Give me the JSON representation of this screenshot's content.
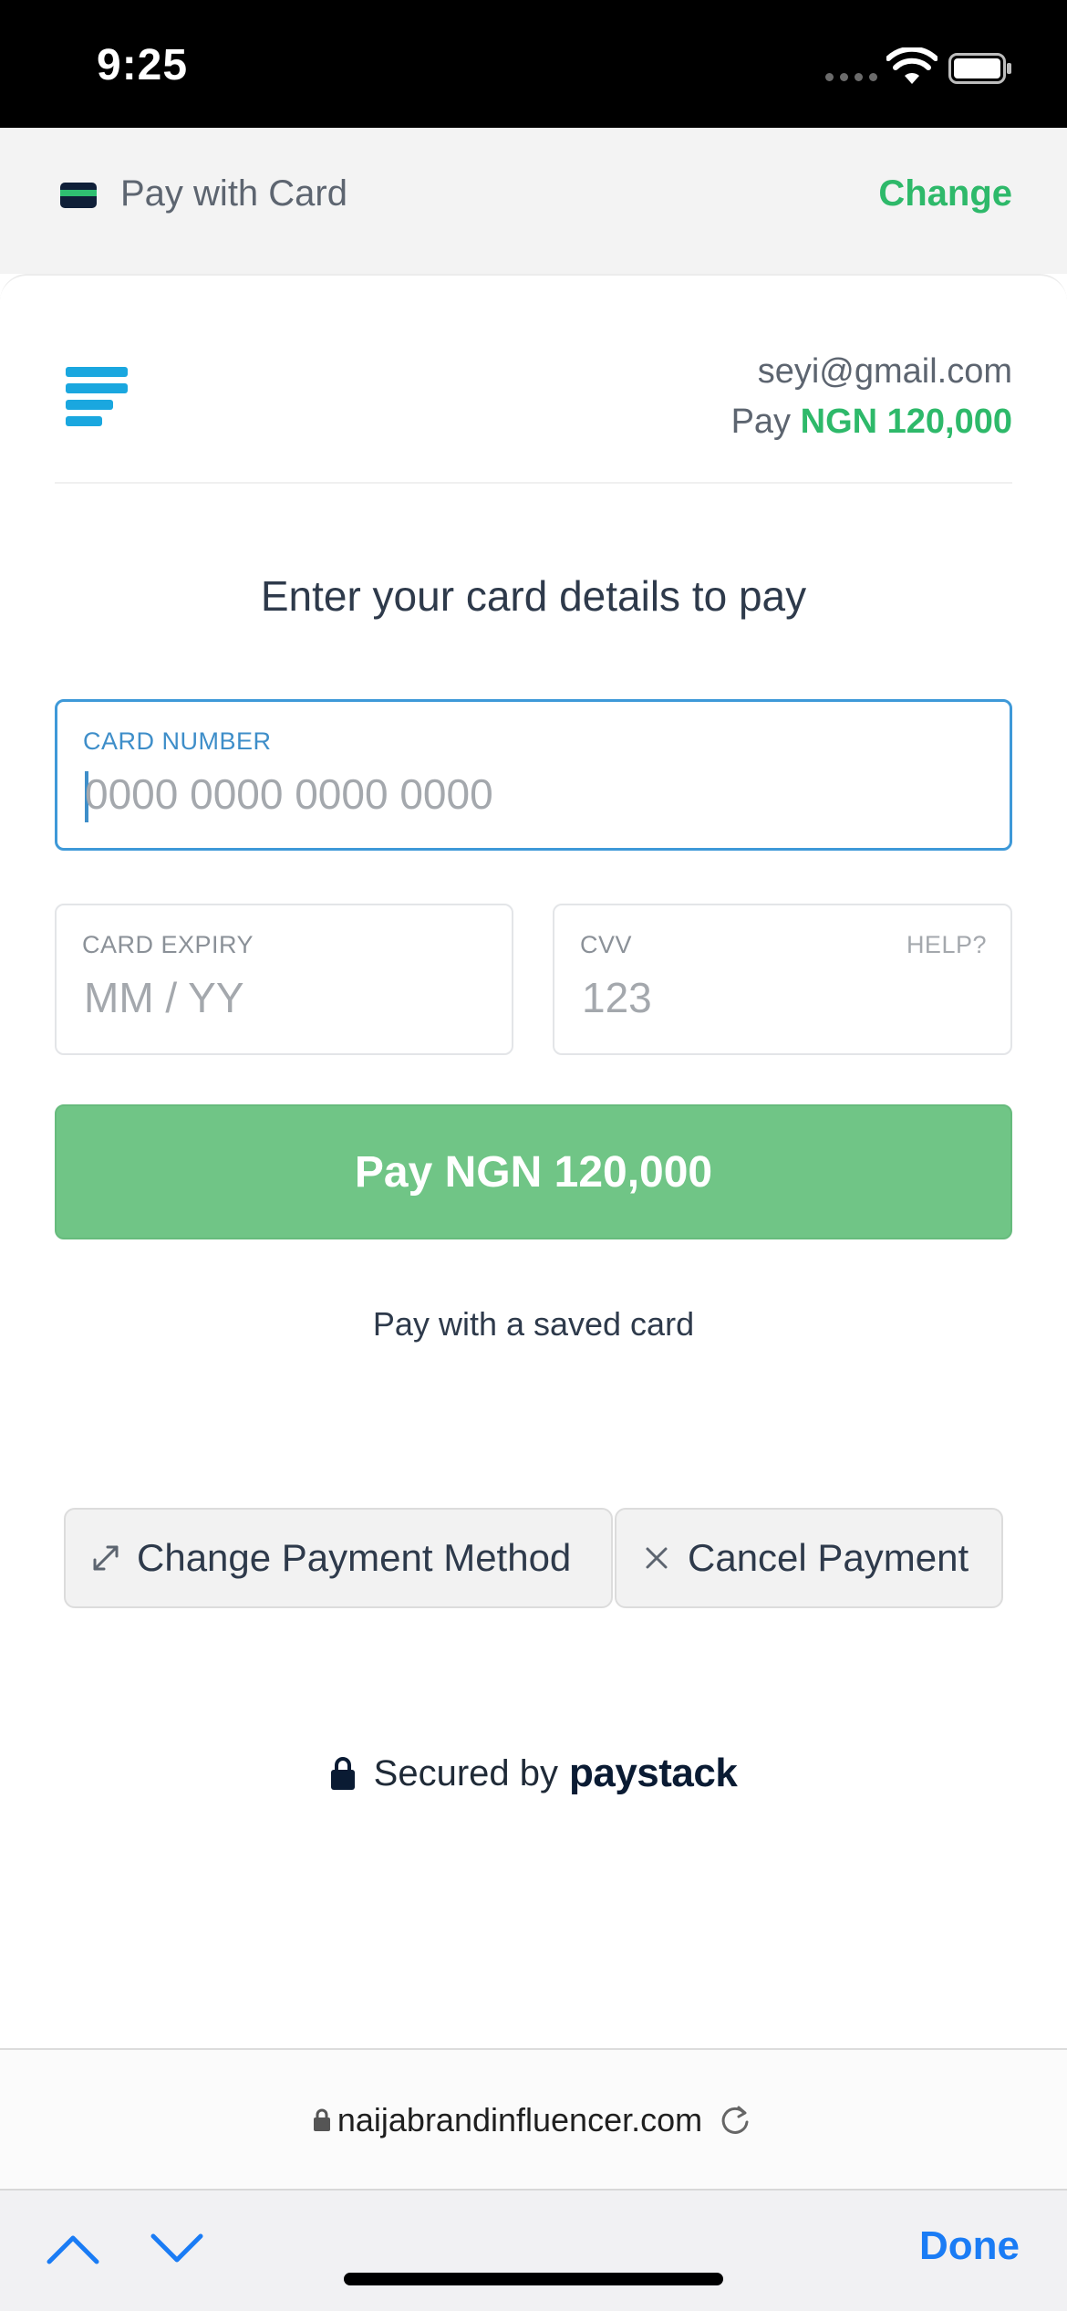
{
  "status_bar": {
    "time": "9:25"
  },
  "header": {
    "title": "Pay with Card",
    "change_label": "Change"
  },
  "merchant": {
    "email": "seyi@gmail.com",
    "pay_prefix": "Pay",
    "amount": "NGN 120,000"
  },
  "form": {
    "heading": "Enter your card details to pay",
    "card_number": {
      "label": "CARD NUMBER",
      "placeholder": "0000 0000 0000 0000",
      "value": ""
    },
    "card_expiry": {
      "label": "CARD EXPIRY",
      "placeholder": "MM / YY",
      "value": ""
    },
    "cvv": {
      "label": "CVV",
      "help_label": "HELP?",
      "placeholder": "123",
      "value": ""
    },
    "pay_button_label": "Pay NGN 120,000",
    "saved_card_link": "Pay with a saved card"
  },
  "actions": {
    "change_method_label": "Change Payment Method",
    "cancel_label": "Cancel Payment"
  },
  "footer": {
    "secured_by": "Secured by",
    "brand": "paystack"
  },
  "browser": {
    "url": "naijabrandinfluencer.com",
    "done_label": "Done"
  },
  "colors": {
    "accent_green": "#2eb96a",
    "button_green": "#70c586",
    "focus_blue": "#3e99d8",
    "logo_blue": "#1aa7df",
    "ios_blue": "#1a7cf5"
  }
}
